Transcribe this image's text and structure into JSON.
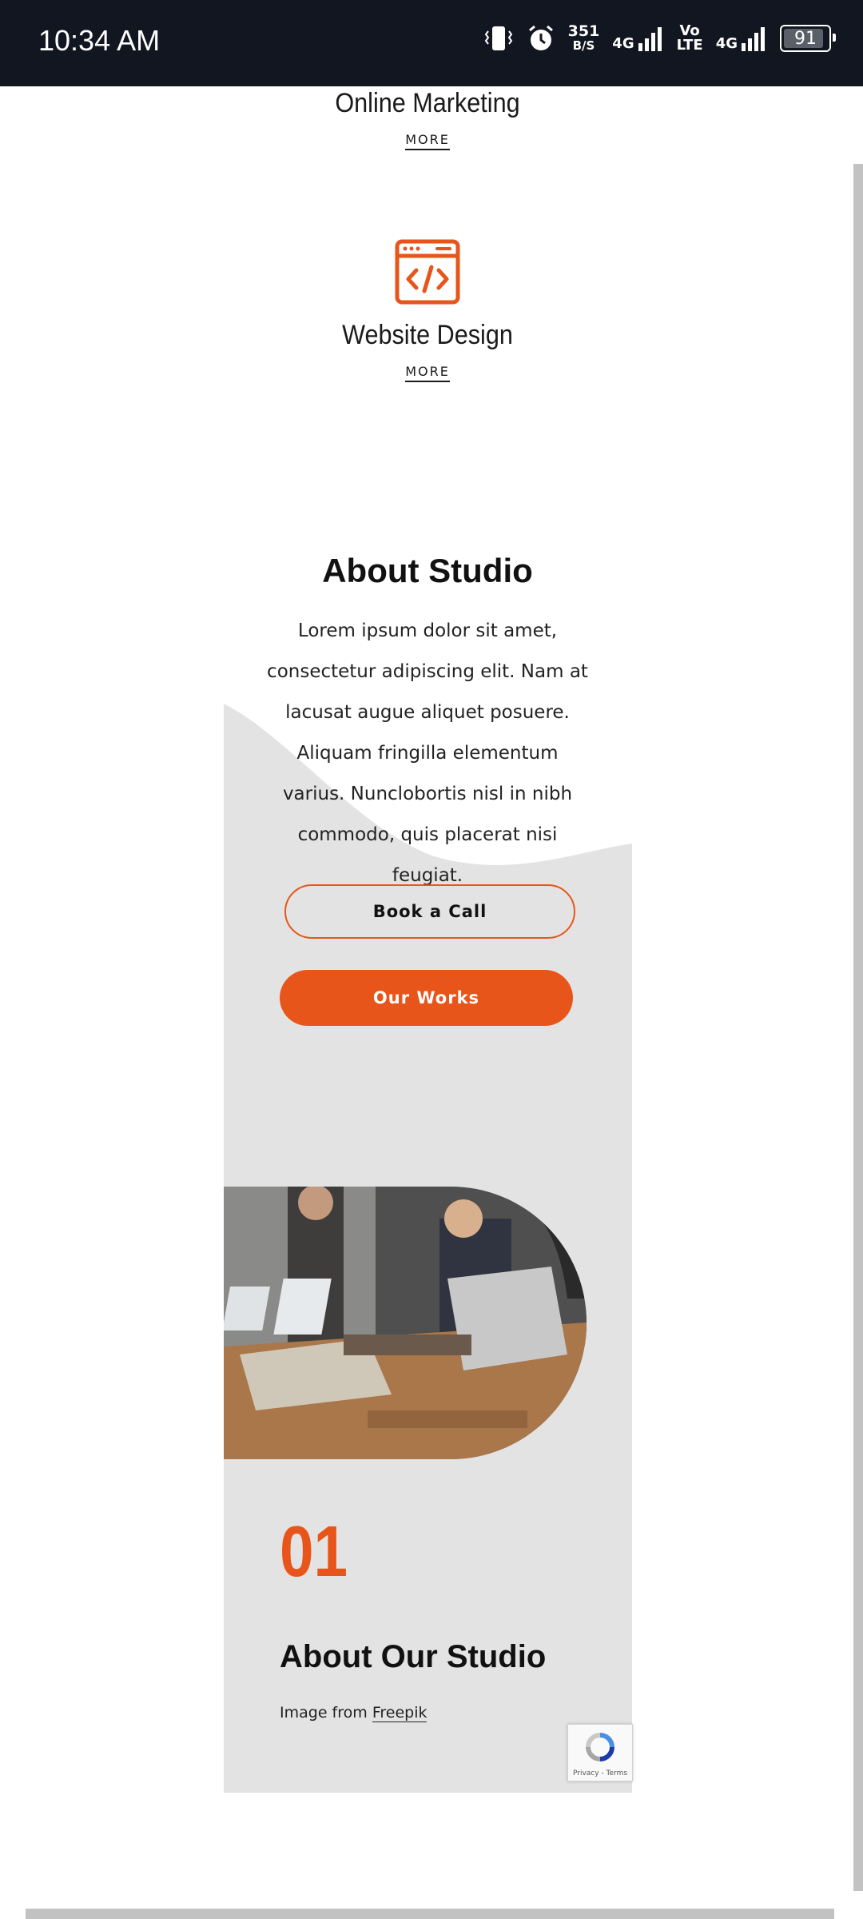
{
  "status_bar": {
    "time": "10:34 AM",
    "data_rate_value": "351",
    "data_rate_unit": "B/S",
    "network_1": "4G",
    "volte_top": "Vo",
    "volte_bottom": "LTE",
    "network_2": "4G",
    "battery": "91"
  },
  "services": [
    {
      "title": "Online Marketing",
      "more": "MORE"
    },
    {
      "title": "Website Design",
      "more": "MORE",
      "icon": "code-window-icon"
    }
  ],
  "about": {
    "title": "About Studio",
    "body": "Lorem ipsum dolor sit amet, consectetur adipiscing elit. Nam at lacusat augue aliquet posuere. Aliquam fringilla elementum varius. Nunclobortis nisl in nibh commodo, quis placerat nisi feugiat.",
    "book_call": "Book a Call",
    "our_works": "Our Works"
  },
  "studio": {
    "number": "01",
    "title": "About Our Studio",
    "credit_prefix": "Image from",
    "credit_link": "Freepik"
  },
  "recaptcha": {
    "terms": "Privacy - Terms"
  },
  "colors": {
    "accent": "#e8551a",
    "panel": "#e4e3e3",
    "statusbar": "#121620"
  }
}
